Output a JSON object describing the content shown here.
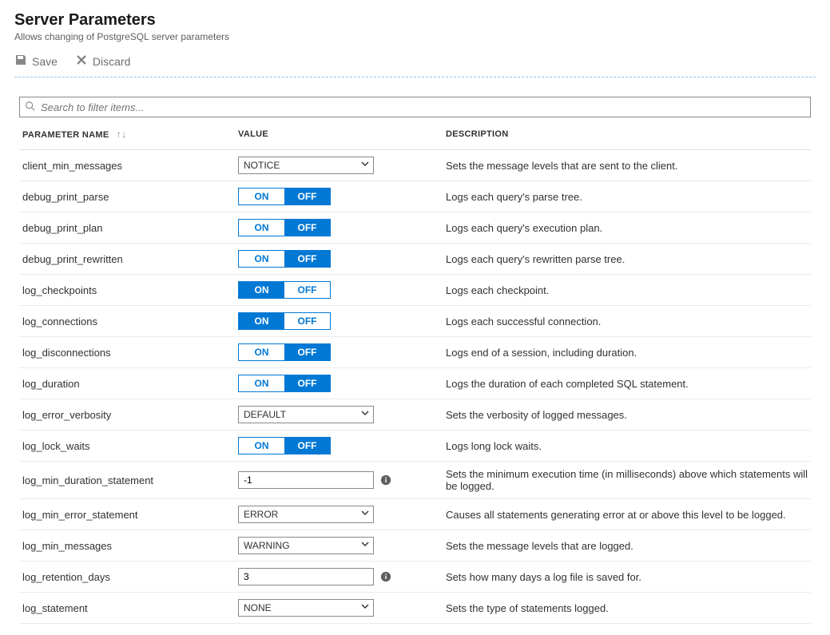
{
  "header": {
    "title": "Server Parameters",
    "subtitle": "Allows changing of PostgreSQL server parameters"
  },
  "toolbar": {
    "save_label": "Save",
    "discard_label": "Discard"
  },
  "search": {
    "placeholder": "Search to filter items..."
  },
  "columns": {
    "name": "PARAMETER NAME",
    "value": "VALUE",
    "description": "DESCRIPTION"
  },
  "toggle_labels": {
    "on": "ON",
    "off": "OFF"
  },
  "parameters": [
    {
      "name": "client_min_messages",
      "type": "select",
      "value": "NOTICE",
      "description": "Sets the message levels that are sent to the client."
    },
    {
      "name": "debug_print_parse",
      "type": "toggle",
      "value": "OFF",
      "description": "Logs each query's parse tree."
    },
    {
      "name": "debug_print_plan",
      "type": "toggle",
      "value": "OFF",
      "description": "Logs each query's execution plan."
    },
    {
      "name": "debug_print_rewritten",
      "type": "toggle",
      "value": "OFF",
      "description": "Logs each query's rewritten parse tree."
    },
    {
      "name": "log_checkpoints",
      "type": "toggle",
      "value": "ON",
      "description": "Logs each checkpoint."
    },
    {
      "name": "log_connections",
      "type": "toggle",
      "value": "ON",
      "description": "Logs each successful connection."
    },
    {
      "name": "log_disconnections",
      "type": "toggle",
      "value": "OFF",
      "description": "Logs end of a session, including duration."
    },
    {
      "name": "log_duration",
      "type": "toggle",
      "value": "OFF",
      "description": "Logs the duration of each completed SQL statement."
    },
    {
      "name": "log_error_verbosity",
      "type": "select",
      "value": "DEFAULT",
      "description": "Sets the verbosity of logged messages."
    },
    {
      "name": "log_lock_waits",
      "type": "toggle",
      "value": "OFF",
      "description": "Logs long lock waits."
    },
    {
      "name": "log_min_duration_statement",
      "type": "input",
      "value": "-1",
      "info": true,
      "description": "Sets the minimum execution time (in milliseconds) above which statements will be logged."
    },
    {
      "name": "log_min_error_statement",
      "type": "select",
      "value": "ERROR",
      "description": "Causes all statements generating error at or above this level to be logged."
    },
    {
      "name": "log_min_messages",
      "type": "select",
      "value": "WARNING",
      "description": "Sets the message levels that are logged."
    },
    {
      "name": "log_retention_days",
      "type": "input",
      "value": "3",
      "info": true,
      "description": "Sets how many days a log file is saved for."
    },
    {
      "name": "log_statement",
      "type": "select",
      "value": "NONE",
      "description": "Sets the type of statements logged."
    }
  ]
}
